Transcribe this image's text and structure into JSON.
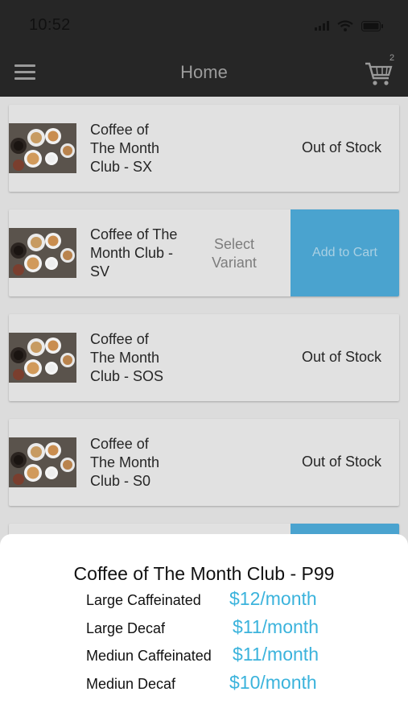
{
  "status_bar": {
    "time": "10:52"
  },
  "nav": {
    "title": "Home",
    "cart_count": "2"
  },
  "products": [
    {
      "name_lines": [
        "Coffee of",
        "The Month",
        "Club - SX"
      ],
      "status": "Out of Stock"
    },
    {
      "name_lines": [
        "Coffee of The",
        "Month Club -",
        "SV"
      ],
      "variant_lines": [
        "Select",
        "Variant"
      ],
      "add_to_cart": "Add to Cart"
    },
    {
      "name_lines": [
        "Coffee of",
        "The Month",
        "Club - SOS"
      ],
      "status": "Out of Stock"
    },
    {
      "name_lines": [
        "Coffee of",
        "The Month",
        "Club - S0"
      ],
      "status": "Out of Stock"
    }
  ],
  "sheet": {
    "title": "Coffee of The Month Club - P99",
    "prices": [
      {
        "label": "Large Caffeinated",
        "value": "$12/month"
      },
      {
        "label": "Large Decaf",
        "value": "$11/month"
      },
      {
        "label": "Mediun Caffeinated",
        "value": "$11/month"
      },
      {
        "label": "Mediun Decaf",
        "value": "$10/month"
      }
    ]
  },
  "colors": {
    "nav_background": "#262626",
    "accent_button": "#4aa3cf",
    "price_text": "#3bb3dc",
    "overlay_dim": "#dcdcdc"
  },
  "icons": [
    "menu-icon",
    "cart-icon",
    "signal-icon",
    "wifi-icon",
    "battery-icon"
  ]
}
